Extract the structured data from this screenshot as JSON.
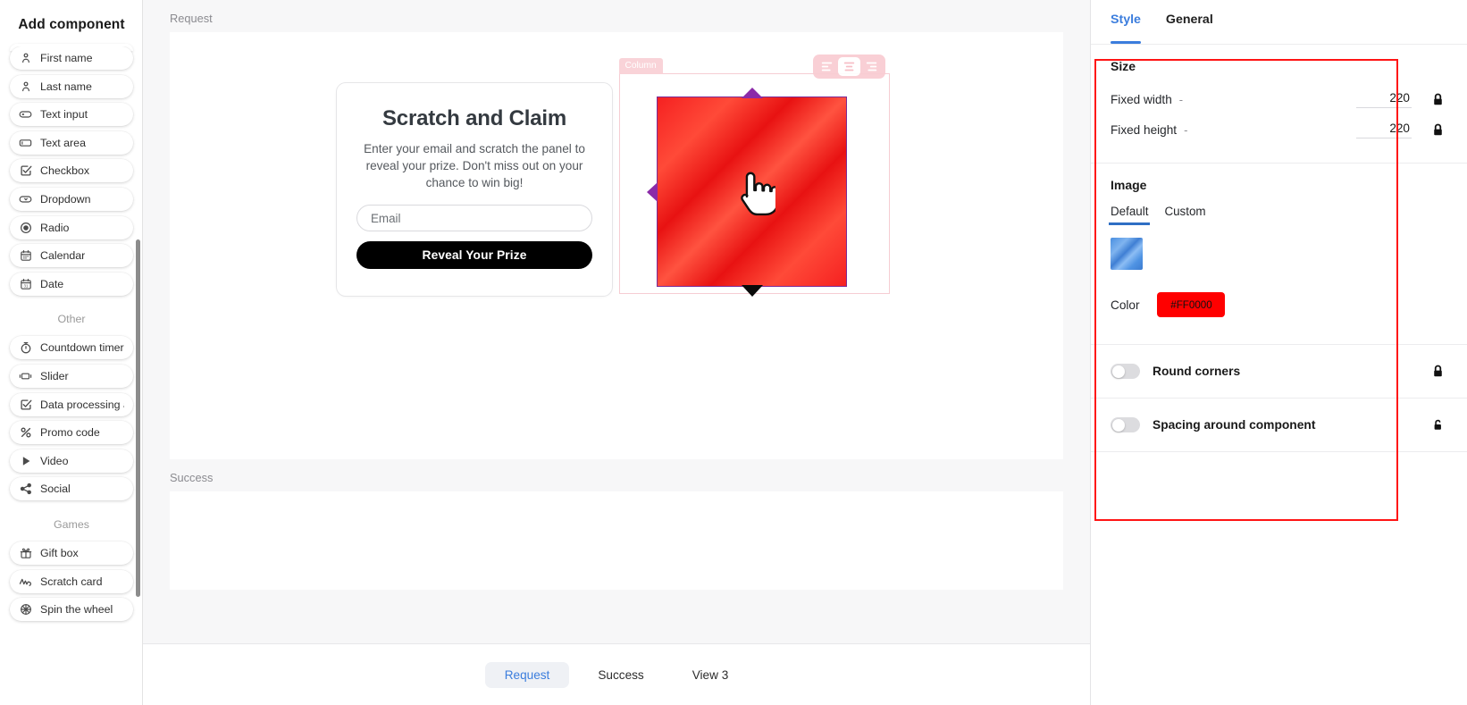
{
  "sidebar": {
    "title": "Add component",
    "groups": [
      {
        "heading": "",
        "items": [
          {
            "label": "First name",
            "icon": "person-icon"
          },
          {
            "label": "Last name",
            "icon": "person-icon"
          },
          {
            "label": "Text input",
            "icon": "text-input-icon"
          },
          {
            "label": "Text area",
            "icon": "text-area-icon"
          },
          {
            "label": "Checkbox",
            "icon": "checkbox-icon"
          },
          {
            "label": "Dropdown",
            "icon": "dropdown-icon"
          },
          {
            "label": "Radio",
            "icon": "radio-icon"
          },
          {
            "label": "Calendar",
            "icon": "calendar-icon"
          },
          {
            "label": "Date",
            "icon": "date-icon"
          }
        ]
      },
      {
        "heading": "Other",
        "items": [
          {
            "label": "Countdown timer",
            "icon": "timer-icon"
          },
          {
            "label": "Slider",
            "icon": "slider-icon"
          },
          {
            "label": "Data processing a",
            "icon": "checkbox-icon"
          },
          {
            "label": "Promo code",
            "icon": "percent-icon"
          },
          {
            "label": "Video",
            "icon": "play-icon"
          },
          {
            "label": "Social",
            "icon": "share-icon"
          }
        ]
      },
      {
        "heading": "Games",
        "items": [
          {
            "label": "Gift box",
            "icon": "gift-icon"
          },
          {
            "label": "Scratch card",
            "icon": "scratch-icon"
          },
          {
            "label": "Spin the wheel",
            "icon": "wheel-icon"
          }
        ]
      }
    ]
  },
  "canvas": {
    "request_label": "Request",
    "success_label": "Success",
    "promo": {
      "title": "Scratch and Claim",
      "subtitle": "Enter your email and scratch the panel to reveal your prize. Don't miss out on your chance to win big!",
      "email_placeholder": "Email",
      "email_value": "",
      "button_label": "Reveal Your Prize"
    },
    "selection": {
      "column_tag": "Column",
      "align_buttons": [
        {
          "name": "align-left-icon",
          "active": false
        },
        {
          "name": "align-center-icon",
          "active": true
        },
        {
          "name": "align-right-icon",
          "active": false
        }
      ],
      "scratch_color": "#FF0000",
      "border_color": "#7B2A96"
    },
    "view_tabs": [
      {
        "label": "Request",
        "active": true
      },
      {
        "label": "Success",
        "active": false
      },
      {
        "label": "View 3",
        "active": false
      }
    ]
  },
  "right_panel": {
    "tabs": [
      {
        "label": "Style",
        "active": true
      },
      {
        "label": "General",
        "active": false
      }
    ],
    "size": {
      "heading": "Size",
      "fixed_width_label": "Fixed width",
      "fixed_width_value": "220",
      "fixed_height_label": "Fixed height",
      "fixed_height_value": "220",
      "dash": "-"
    },
    "image": {
      "heading": "Image",
      "subtabs": [
        {
          "label": "Default",
          "active": true
        },
        {
          "label": "Custom",
          "active": false
        }
      ],
      "color_label": "Color",
      "color_value": "#FF0000"
    },
    "round_corners": {
      "label": "Round corners",
      "enabled": false
    },
    "spacing": {
      "label": "Spacing around component",
      "enabled": false
    },
    "accent_color": "#3B7DDD",
    "highlight_outline_color": "#FF1414"
  }
}
